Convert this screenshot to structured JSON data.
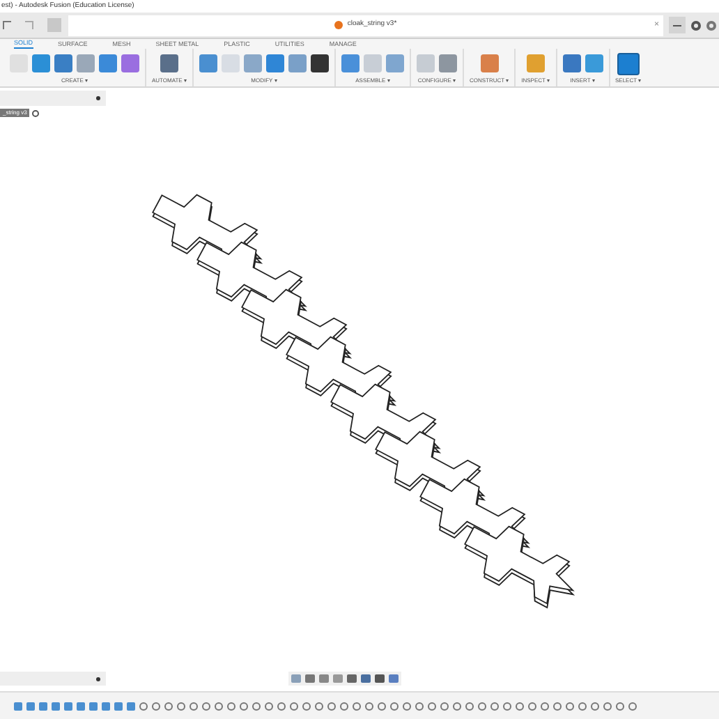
{
  "window": {
    "title": "est) - Autodesk Fusion (Education License)"
  },
  "document_tab": {
    "title": "cloak_string v3*",
    "close": "×"
  },
  "toolbar_tabs": [
    {
      "label": "SOLID",
      "selected": true
    },
    {
      "label": "SURFACE",
      "selected": false
    },
    {
      "label": "MESH",
      "selected": false
    },
    {
      "label": "SHEET METAL",
      "selected": false
    },
    {
      "label": "PLASTIC",
      "selected": false
    },
    {
      "label": "UTILITIES",
      "selected": false
    },
    {
      "label": "MANAGE",
      "selected": false
    }
  ],
  "toolbar_groups": [
    {
      "label": "CREATE ▾"
    },
    {
      "label": "AUTOMATE ▾"
    },
    {
      "label": "MODIFY ▾"
    },
    {
      "label": "ASSEMBLE ▾"
    },
    {
      "label": "CONFIGURE ▾"
    },
    {
      "label": "CONSTRUCT ▾"
    },
    {
      "label": "INSPECT ▾"
    },
    {
      "label": "INSERT ▾"
    },
    {
      "label": "SELECT ▾"
    }
  ],
  "browser": {
    "root_label": "_string v3"
  }
}
